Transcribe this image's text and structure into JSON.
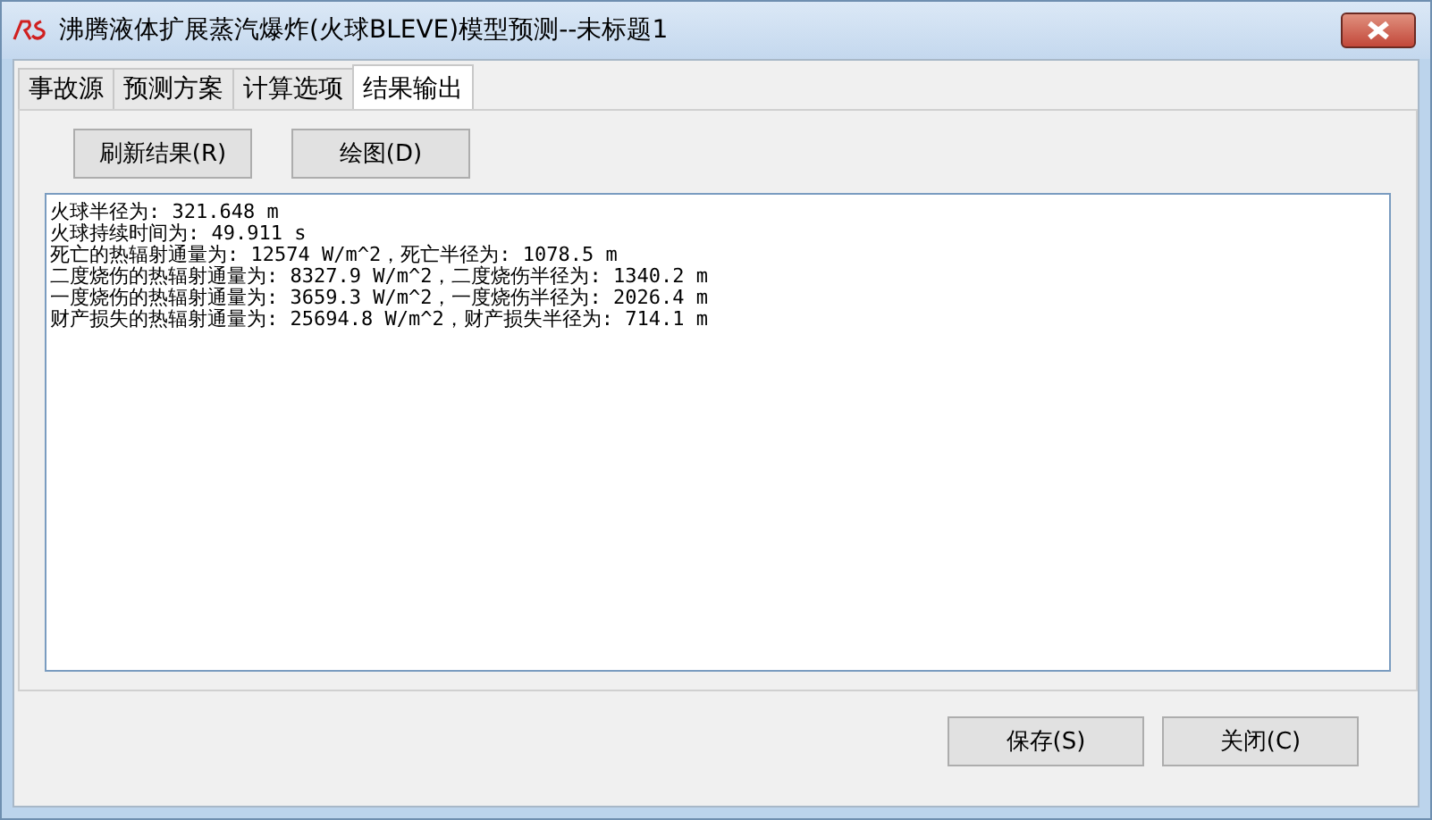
{
  "window": {
    "title": "沸腾液体扩展蒸汽爆炸(火球BLEVE)模型预测--未标题1"
  },
  "tabs": [
    {
      "label": "事故源",
      "selected": false
    },
    {
      "label": "预测方案",
      "selected": false
    },
    {
      "label": "计算选项",
      "selected": false
    },
    {
      "label": "结果输出",
      "selected": true
    }
  ],
  "toolbar_buttons": [
    "刷新结果(R)",
    "绘图(D)"
  ],
  "results": [
    "火球半径为: 321.648 m",
    "火球持续时间为: 49.911 s",
    "死亡的热辐射通量为: 12574 W/m^2，死亡半径为: 1078.5 m",
    "二度烧伤的热辐射通量为: 8327.9 W/m^2，二度烧伤半径为: 1340.2 m",
    "一度烧伤的热辐射通量为: 3659.3 W/m^2，一度烧伤半径为: 2026.4 m",
    "财产损失的热辐射通量为: 25694.8 W/m^2，财产损失半径为: 714.1 m"
  ],
  "footer_buttons": [
    "保存(S)",
    "关闭(C)"
  ]
}
